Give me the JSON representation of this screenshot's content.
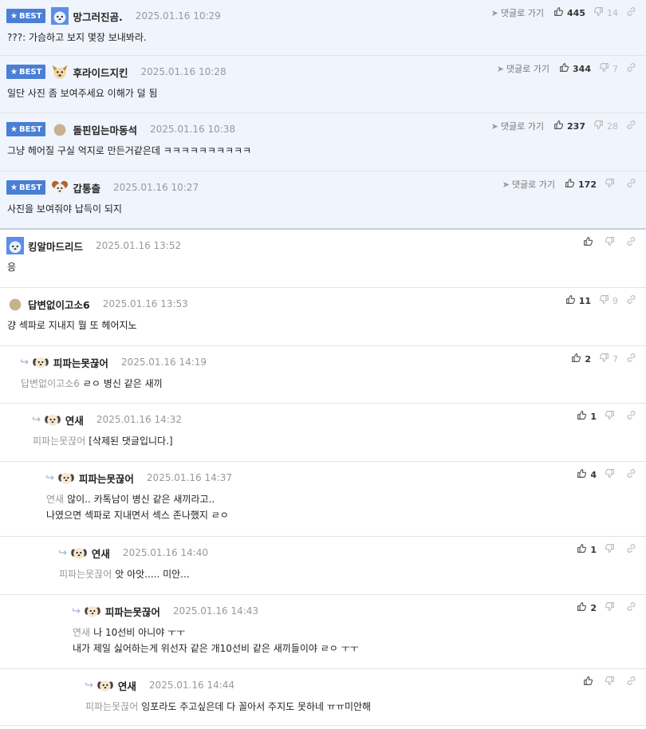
{
  "best_label": "BEST",
  "goto_label": "댓글로 가기",
  "colors": {
    "best_badge": "#4a7fd6",
    "best_bg": "#f0f4fc",
    "reply_arrow": "#9db0cf"
  },
  "comments": [
    {
      "best": true,
      "avatar": "blue-puppy-avatar",
      "nick": "망그러진곰.",
      "date": "2025.01.16 10:29",
      "text": "???: 가슴하고 보지 몇장 보내봐라.",
      "up": "445",
      "down": "14",
      "goto": true
    },
    {
      "best": true,
      "avatar": "dog-face-avatar",
      "nick": "후라이드지킨",
      "date": "2025.01.16 10:28",
      "text": "일단 사진 좀 보여주세요 이해가 덜 됨",
      "up": "344",
      "down": "7",
      "goto": true
    },
    {
      "best": true,
      "avatar": "tan-circle-avatar",
      "nick": "돌핀입는마동석",
      "date": "2025.01.16 10:38",
      "text": "그냥 헤어질 구실 억지로 만든거같은데 ㅋㅋㅋㅋㅋㅋㅋㅋㅋㅋ",
      "up": "237",
      "down": "28",
      "goto": true
    },
    {
      "best": true,
      "avatar": "poodle-avatar",
      "nick": "갑통출",
      "date": "2025.01.16 10:27",
      "text": "사진을 보여줘야 납득이 되지",
      "up": "172",
      "down": "",
      "goto": true
    },
    {
      "best": false,
      "avatar": "blue-puppy-avatar",
      "nick": "킹알마드리드",
      "date": "2025.01.16 13:52",
      "text": "응",
      "up": "",
      "down": ""
    },
    {
      "best": false,
      "avatar": "tan-circle-avatar",
      "nick": "답변없이고소6",
      "date": "2025.01.16 13:53",
      "text": "걍 섹파로 지내지 뭘 또 헤어지노",
      "up": "11",
      "down": "9"
    },
    {
      "best": false,
      "reply": true,
      "avatar": "puppy-avatar",
      "nick": "피파는못끊어",
      "date": "2025.01.16 14:19",
      "target": "답변없이고소6",
      "text": "ㄹㅇ 병신 같은 새끼",
      "up": "2",
      "down": "7"
    },
    {
      "best": false,
      "reply": true,
      "avatar": "puppy-avatar",
      "nick": "연새",
      "date": "2025.01.16 14:32",
      "target": "피파는못끊어",
      "text": "[삭제된 댓글입니다.]",
      "up": "1",
      "down": ""
    },
    {
      "best": false,
      "reply": true,
      "avatar": "puppy-avatar",
      "nick": "피파는못끊어",
      "date": "2025.01.16 14:37",
      "target": "연새",
      "text": "않이.. 카톡남이 병신 같은 새끼라고..\n나였으면 섹파로 지내면서 섹스 존나했지 ㄹㅇ",
      "up": "4",
      "down": ""
    },
    {
      "best": false,
      "reply": true,
      "avatar": "puppy-avatar",
      "nick": "연새",
      "date": "2025.01.16 14:40",
      "target": "피파는못끊어",
      "text": "앗 아앗..... 미안...",
      "up": "1",
      "down": ""
    },
    {
      "best": false,
      "reply": true,
      "avatar": "puppy-avatar",
      "nick": "피파는못끊어",
      "date": "2025.01.16 14:43",
      "target": "연새",
      "text": "나 10선비 아니야 ㅜㅜ\n내가 제일 싫어하는게 위선자 같은 개10선비 같은 새끼들이야 ㄹㅇ ㅜㅜ",
      "up": "2",
      "down": ""
    },
    {
      "best": false,
      "reply": true,
      "avatar": "puppy-avatar",
      "nick": "연새",
      "date": "2025.01.16 14:44",
      "target": "피파는못끊어",
      "text": "잉포라도 주고싶은데 다 꼴아서 주지도 못하네 ㅠㅠ미안해",
      "up": "",
      "down": ""
    }
  ]
}
